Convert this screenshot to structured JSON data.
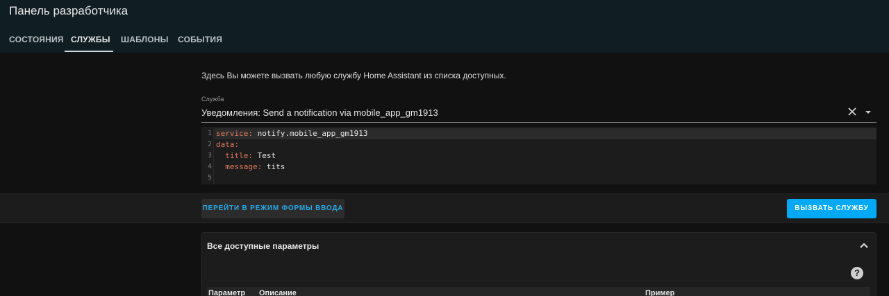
{
  "header": {
    "title": "Панель разработчика",
    "tabs": [
      {
        "label": "СОСТОЯНИЯ"
      },
      {
        "label": "СЛУЖБЫ"
      },
      {
        "label": "ШАБЛОНЫ"
      },
      {
        "label": "СОБЫТИЯ"
      }
    ],
    "active_tab": "СЛУЖБЫ"
  },
  "main": {
    "intro": "Здесь Вы можете вызвать любую службу Home Assistant из списка доступных.",
    "service_field": {
      "label": "Служба",
      "value": "Уведомления: Send a notification via mobile_app_gm1913",
      "clear_icon": "close-icon",
      "dropdown_icon": "caret-down-icon"
    },
    "editor": {
      "lines": [
        {
          "num": "1",
          "key": "service:",
          "value": " notify.mobile_app_gm1913",
          "indent": ""
        },
        {
          "num": "2",
          "key": "data:",
          "value": "",
          "indent": ""
        },
        {
          "num": "3",
          "key": "title:",
          "value": " Test",
          "indent": "  "
        },
        {
          "num": "4",
          "key": "message:",
          "value": " tits",
          "indent": "  "
        },
        {
          "num": "5",
          "key": "",
          "value": "",
          "indent": ""
        }
      ]
    },
    "actions": {
      "form_mode_label": "ПЕРЕЙТИ В РЕЖИМ ФОРМЫ ВВОДА",
      "call_service_label": "ВЫЗВАТЬ СЛУЖБУ"
    },
    "params_panel": {
      "title": "Все доступные параметры",
      "collapse_icon": "chevron-up-icon",
      "help_icon": "help-circle-icon",
      "columns": [
        "Параметр",
        "Описание",
        "Пример"
      ]
    }
  },
  "colors": {
    "header_bg": "#101e24",
    "accent": "#03a9f4",
    "yaml_key": "#e07a5f"
  }
}
